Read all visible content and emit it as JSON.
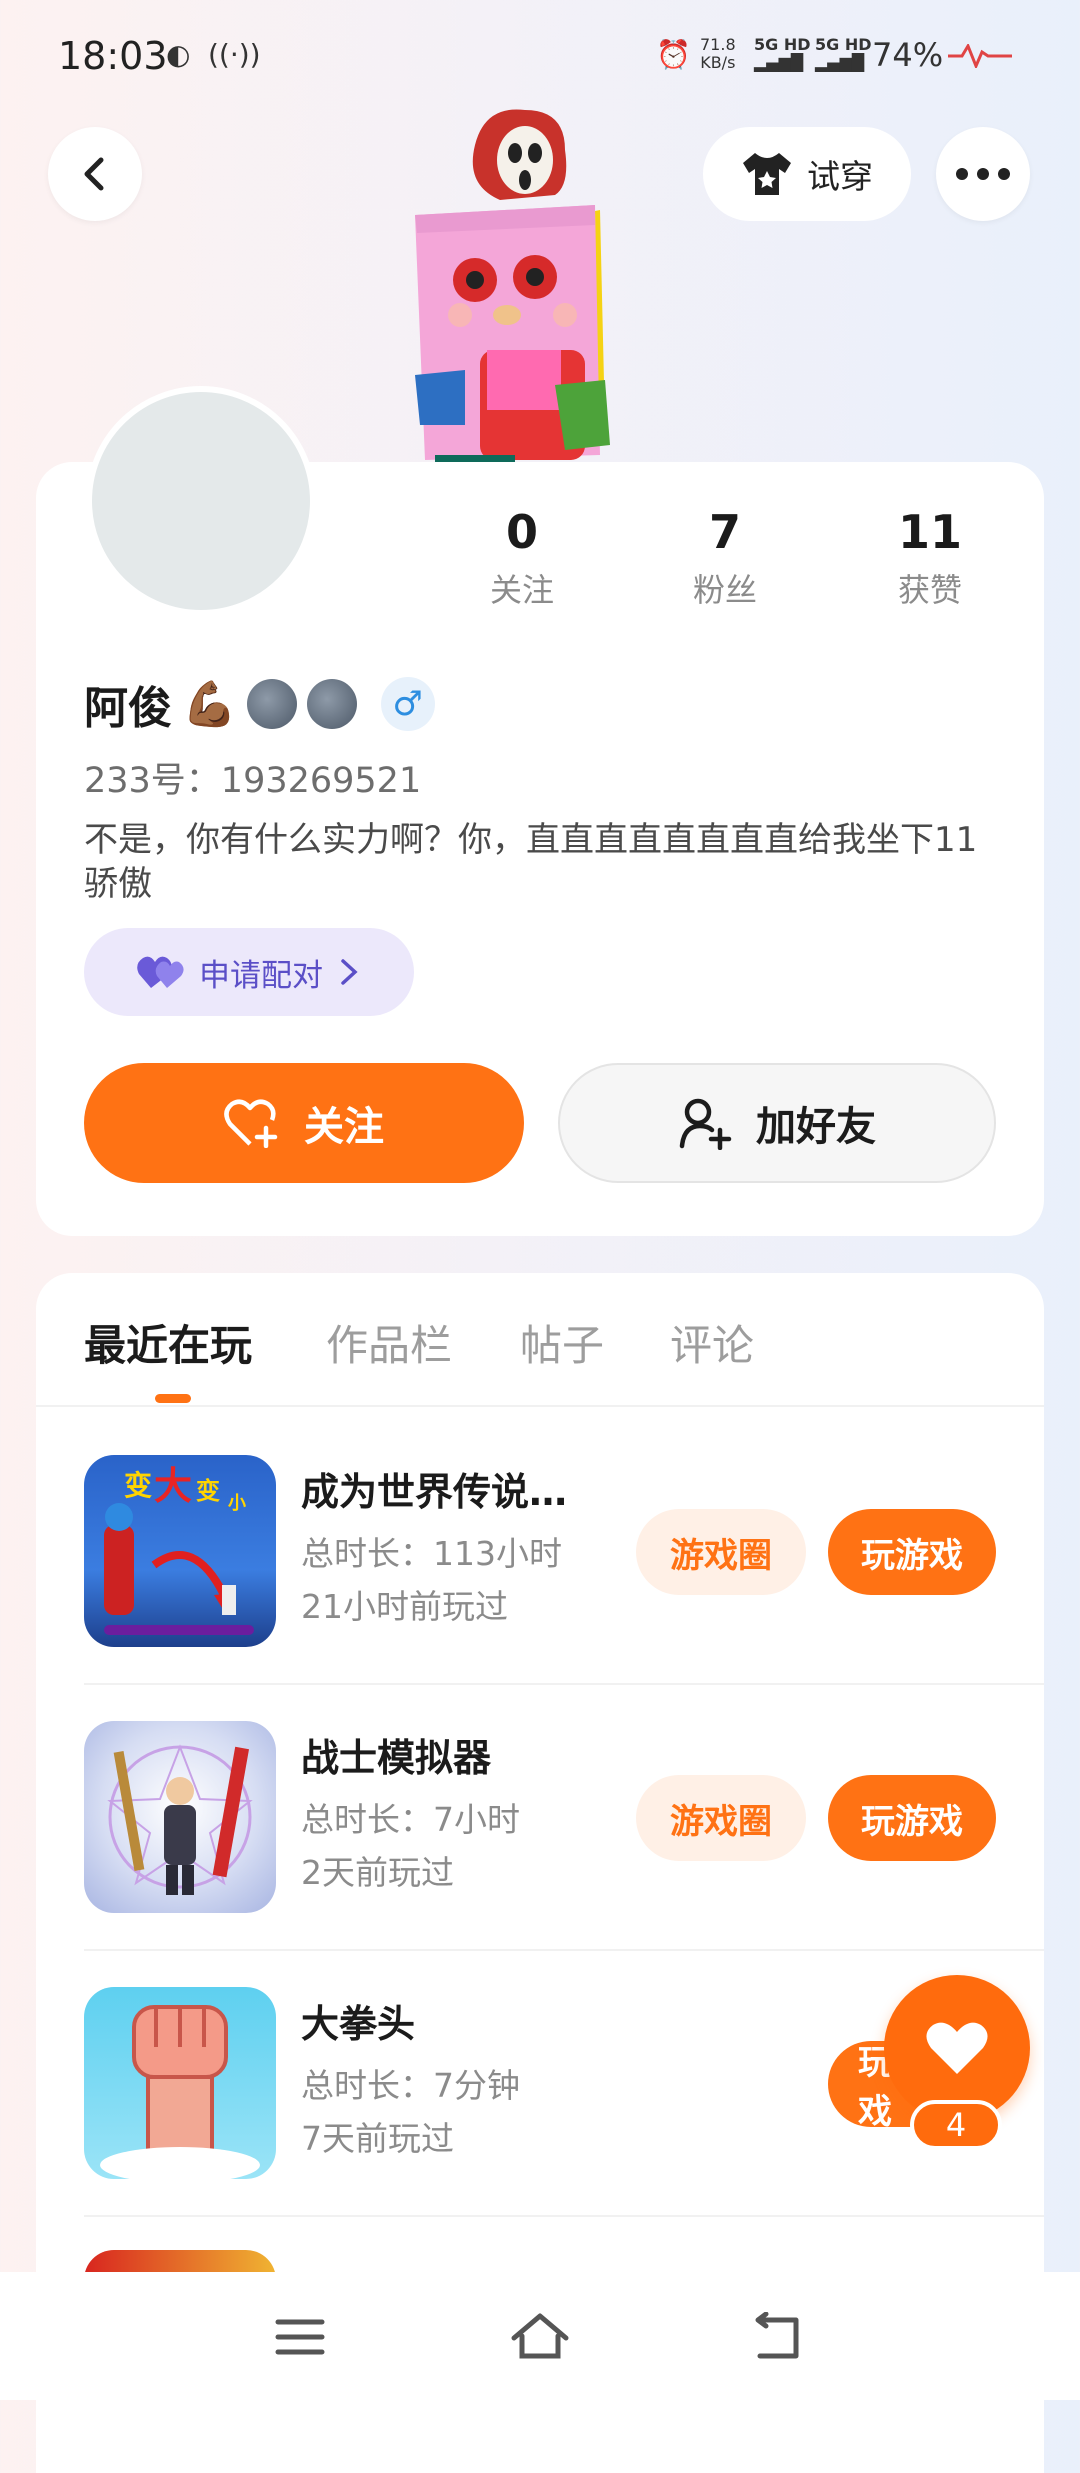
{
  "status_bar": {
    "time": "18:03",
    "speed_value": "71.8",
    "speed_unit": "KB/s",
    "net1": "5G HD",
    "net2": "5G HD",
    "battery": "74%"
  },
  "header": {
    "tryon_label": "试穿"
  },
  "profile": {
    "stats": [
      {
        "num": "0",
        "label": "关注"
      },
      {
        "num": "7",
        "label": "粉丝"
      },
      {
        "num": "11",
        "label": "获赞"
      }
    ],
    "name": "阿俊",
    "name_emoji": "💪🏾",
    "gender_symbol": "♂",
    "user_id": "233号：193269521",
    "bio": "不是，你有什么实力啊？你，直直直直直直直直给我坐下11骄傲",
    "pair_label": "申请配对",
    "follow_label": "关注",
    "add_friend_label": "加好友"
  },
  "tabs": [
    "最近在玩",
    "作品栏",
    "帖子",
    "评论"
  ],
  "games": [
    {
      "title": "成为世界传说…",
      "duration": "总时长：113小时",
      "last_played": "21小时前玩过",
      "circle_label": "游戏圈",
      "play_label": "玩游戏",
      "thumb_text1": "变",
      "thumb_text2": "大",
      "thumb_text3": "变",
      "thumb_text4": "小"
    },
    {
      "title": "战士模拟器",
      "duration": "总时长：7小时",
      "last_played": "2天前玩过",
      "circle_label": "游戏圈",
      "play_label": "玩游戏"
    },
    {
      "title": "大拳头",
      "duration": "总时长：7分钟",
      "last_played": "7天前玩过",
      "play_label": "玩游戏"
    }
  ],
  "fab": {
    "count": "4"
  },
  "colors": {
    "accent": "#ff7214",
    "pair_bg": "#ece8fb",
    "pair_text": "#5b4fc7"
  },
  "icons": [
    "back-arrow-icon",
    "tshirt-icon",
    "more-icon",
    "heart-icon",
    "add-person-icon",
    "chevron-right-icon",
    "menu-icon",
    "home-icon",
    "back-icon"
  ]
}
